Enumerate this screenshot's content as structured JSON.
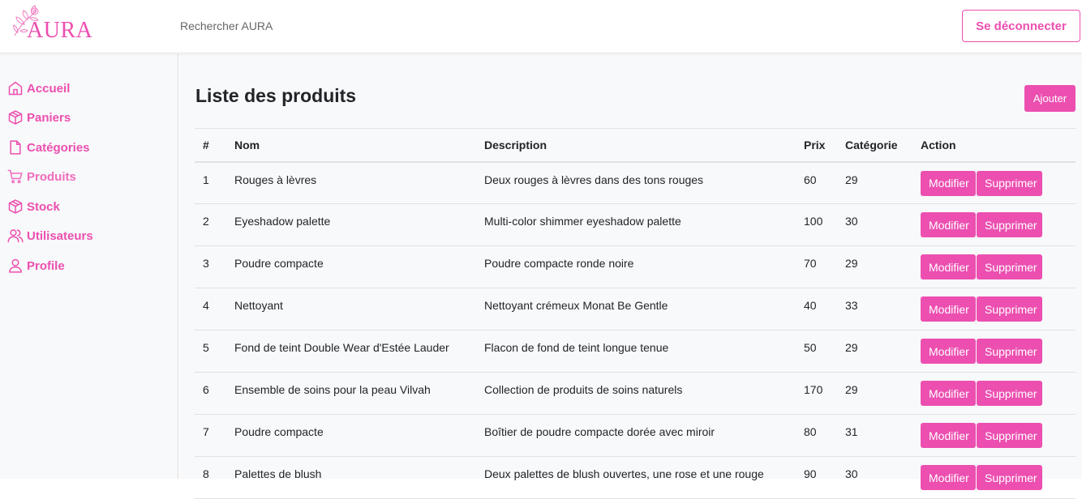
{
  "brand": {
    "name": "AURA",
    "color": "#ec4fb0"
  },
  "header": {
    "search_placeholder": "Rechercher AURA",
    "logout_label": "Se déconnecter"
  },
  "sidebar": {
    "items": [
      {
        "label": "Accueil",
        "icon": "home-icon"
      },
      {
        "label": "Paniers",
        "icon": "box-icon"
      },
      {
        "label": "Catégories",
        "icon": "file-icon"
      },
      {
        "label": "Produits",
        "icon": "cart-icon"
      },
      {
        "label": "Stock",
        "icon": "box-icon"
      },
      {
        "label": "Utilisateurs",
        "icon": "users-icon"
      },
      {
        "label": "Profile",
        "icon": "user-icon"
      }
    ]
  },
  "main": {
    "title": "Liste des produits",
    "add_label": "Ajouter",
    "table": {
      "headers": [
        "#",
        "Nom",
        "Description",
        "Prix",
        "Catégorie",
        "Action"
      ],
      "rows": [
        {
          "id": "1",
          "name": "Rouges à lèvres",
          "description": "Deux rouges à lèvres dans des tons rouges",
          "price": "60",
          "category": "29"
        },
        {
          "id": "2",
          "name": "Eyeshadow palette",
          "description": "Multi-color shimmer eyeshadow palette",
          "price": "100",
          "category": "30"
        },
        {
          "id": "3",
          "name": "Poudre compacte",
          "description": "Poudre compacte ronde noire",
          "price": "70",
          "category": "29"
        },
        {
          "id": "4",
          "name": "Nettoyant",
          "description": "Nettoyant crémeux Monat Be Gentle",
          "price": "40",
          "category": "33"
        },
        {
          "id": "5",
          "name": "Fond de teint Double Wear d'Estée Lauder",
          "description": "Flacon de fond de teint longue tenue",
          "price": "50",
          "category": "29"
        },
        {
          "id": "6",
          "name": "Ensemble de soins pour la peau Vilvah",
          "description": "Collection de produits de soins naturels",
          "price": "170",
          "category": "29"
        },
        {
          "id": "7",
          "name": "Poudre compacte",
          "description": "Boîtier de poudre compacte dorée avec miroir",
          "price": "80",
          "category": "31"
        },
        {
          "id": "8",
          "name": "Palettes de blush",
          "description": "Deux palettes de blush ouvertes, une rose et une rouge",
          "price": "90",
          "category": "30"
        }
      ],
      "edit_label": "Modifier",
      "delete_label": "Supprimer"
    }
  }
}
